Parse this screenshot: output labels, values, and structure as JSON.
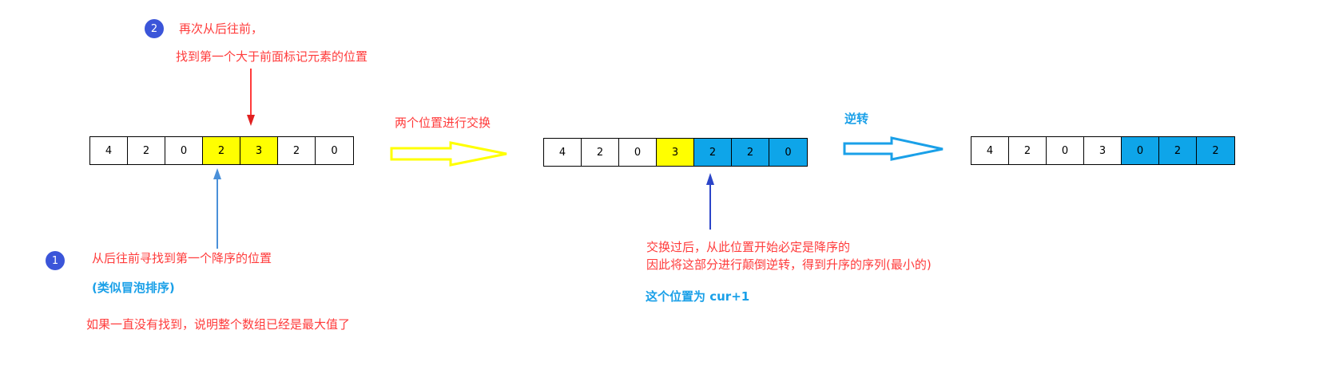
{
  "arrays": {
    "initial": [
      {
        "value": "4",
        "color": "white"
      },
      {
        "value": "2",
        "color": "white"
      },
      {
        "value": "0",
        "color": "white"
      },
      {
        "value": "2",
        "color": "yellow"
      },
      {
        "value": "3",
        "color": "yellow"
      },
      {
        "value": "2",
        "color": "white"
      },
      {
        "value": "0",
        "color": "white"
      }
    ],
    "swapped": [
      {
        "value": "4",
        "color": "white"
      },
      {
        "value": "2",
        "color": "white"
      },
      {
        "value": "0",
        "color": "white"
      },
      {
        "value": "3",
        "color": "yellow"
      },
      {
        "value": "2",
        "color": "blue"
      },
      {
        "value": "2",
        "color": "blue"
      },
      {
        "value": "0",
        "color": "blue"
      }
    ],
    "reversed": [
      {
        "value": "4",
        "color": "white"
      },
      {
        "value": "2",
        "color": "white"
      },
      {
        "value": "0",
        "color": "white"
      },
      {
        "value": "3",
        "color": "white"
      },
      {
        "value": "0",
        "color": "blue"
      },
      {
        "value": "2",
        "color": "blue"
      },
      {
        "value": "2",
        "color": "blue"
      }
    ]
  },
  "step2": {
    "badge": "2",
    "line1": "再次从后往前，",
    "line2": "找到第一个大于前面标记元素的位置"
  },
  "step1": {
    "badge": "1",
    "line1": "从后往前寻找到第一个降序的位置",
    "note": "(类似冒泡排序)",
    "line3": "如果一直没有找到，说明整个数组已经是最大值了"
  },
  "swap_label": "两个位置进行交换",
  "reverse_label": "逆转",
  "after_swap": {
    "line1": "交换过后，从此位置开始必定是降序的",
    "line2": "因此将这部分进行颠倒逆转，得到升序的序列(最小的)",
    "cur_label": "这个位置为 cur+1"
  },
  "colors": {
    "red": "#ff3b3b",
    "cyan": "#1aa0e8",
    "yellow": "#ffff00",
    "blue": "#0ea5e9",
    "badge": "#3b55d9"
  }
}
